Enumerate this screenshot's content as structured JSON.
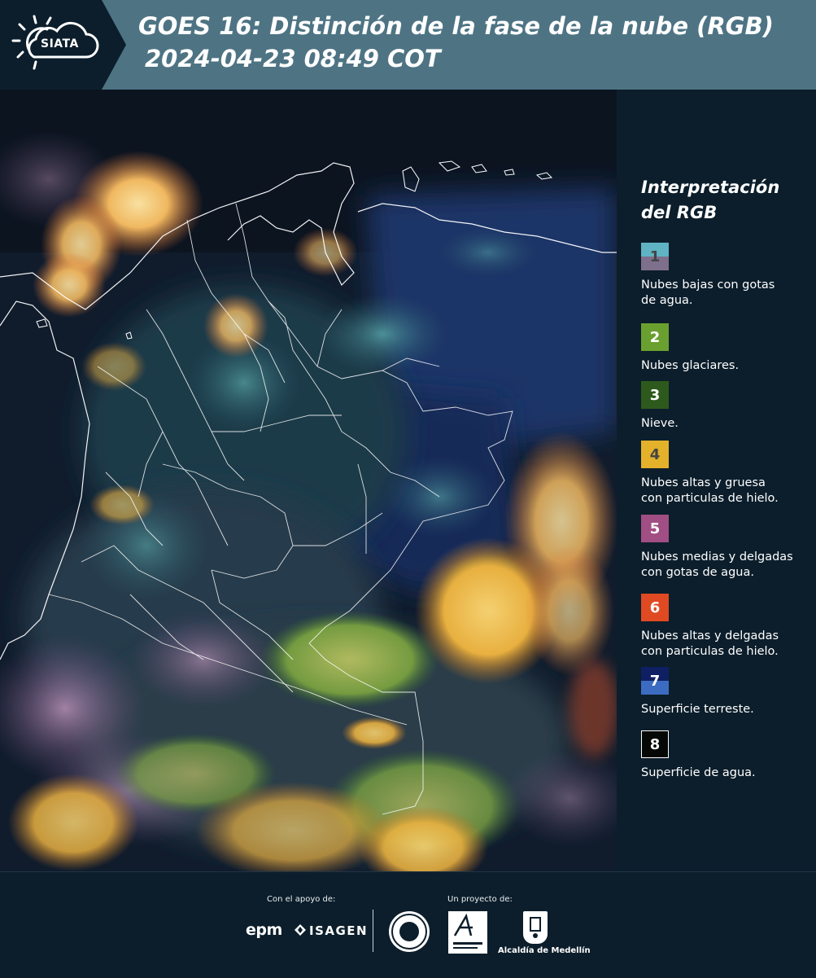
{
  "header": {
    "logo_text": "SIATA",
    "title_line1": "GOES 16: Distinción de la fase de la nube (RGB)",
    "title_line2": "2024-04-23 08:49 COT"
  },
  "legend": {
    "title_line1": "Interpretación",
    "title_line2": "del RGB",
    "items": [
      {
        "number": "1",
        "label_line1": "Nubes bajas con gotas",
        "label_line2": "de agua.",
        "color_top": "#5fb3c3",
        "color_bottom": "#7e6f8c",
        "number_color": "#444444"
      },
      {
        "number": "2",
        "label_line1": "Nubes glaciares.",
        "label_line2": "",
        "color_top": "#6aa02f",
        "color_bottom": "#6aa02f",
        "number_color": "#ffffff"
      },
      {
        "number": "3",
        "label_line1": "Nieve.",
        "label_line2": "",
        "color_top": "#2d5a1c",
        "color_bottom": "#2d5a1c",
        "number_color": "#ffffff"
      },
      {
        "number": "4",
        "label_line1": "Nubes altas y gruesa",
        "label_line2": "con particulas de hielo.",
        "color_top": "#e3b22a",
        "color_bottom": "#e3b22a",
        "number_color": "#444444"
      },
      {
        "number": "5",
        "label_line1": "Nubes medias y delgadas",
        "label_line2": "con gotas de agua.",
        "color_top": "#a04e84",
        "color_bottom": "#a04e84",
        "number_color": "#ffffff"
      },
      {
        "number": "6",
        "label_line1": "Nubes altas y delgadas",
        "label_line2": "con particulas de hielo.",
        "color_top": "#df4a22",
        "color_bottom": "#df4a22",
        "number_color": "#ffffff"
      },
      {
        "number": "7",
        "label_line1": "Superficie terreste.",
        "label_line2": "",
        "color_top": "#0f1f63",
        "color_bottom": "#3c6cc2",
        "number_color": "#ffffff"
      },
      {
        "number": "8",
        "label_line1": "Superficie de agua.",
        "label_line2": "",
        "color_top": "#050805",
        "color_bottom": "#050805",
        "number_color": "#ffffff"
      }
    ]
  },
  "footer": {
    "support_label": "Con el apoyo de:",
    "project_label": "Un proyecto de:",
    "sponsor1": "epm",
    "sponsor2": "ISAGEN",
    "alcaldia": "Alcaldía de Medellín"
  }
}
